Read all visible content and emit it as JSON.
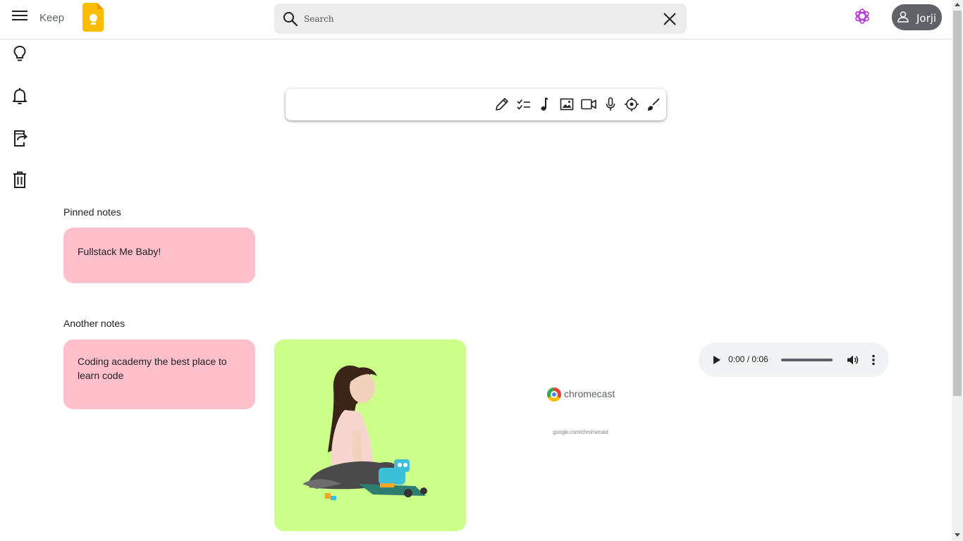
{
  "header": {
    "app_name": "Keep",
    "logo_icon": "keep-lightbulb-logo",
    "search": {
      "placeholder": "Search",
      "value": ""
    },
    "user": {
      "name": "Jorji",
      "icon": "user-icon"
    },
    "ai_icon": "openai-icon"
  },
  "sidebar": {
    "items": [
      {
        "name": "notes",
        "icon": "lightbulb-icon"
      },
      {
        "name": "reminders",
        "icon": "bell-icon"
      },
      {
        "name": "export",
        "icon": "export-icon"
      },
      {
        "name": "trash",
        "icon": "trash-icon"
      }
    ]
  },
  "composer": {
    "tools": [
      "pencil-icon",
      "checklist-icon",
      "music-note-icon",
      "image-icon",
      "video-icon",
      "microphone-icon",
      "location-icon",
      "brush-icon"
    ]
  },
  "pinned": {
    "label": "Pinned notes",
    "notes": [
      {
        "text": "Fullstack Me Baby!",
        "color": "#ffc0cb"
      }
    ]
  },
  "another": {
    "label": "Another notes",
    "notes": [
      {
        "text": "Coding academy the best place to learn code",
        "color": "#ffc0cb"
      }
    ],
    "image_note": {
      "color": "#ccff8a"
    },
    "chromecast": {
      "brand": "chromecast",
      "url": "google.com/chromecast"
    },
    "audio": {
      "time": "0:00 / 0:06",
      "progress": 0
    }
  },
  "colors": {
    "accent": "#fbbc04",
    "user_pill": "#5f6368",
    "note_pink": "#ffc0cb",
    "note_green": "#ccff8a"
  }
}
